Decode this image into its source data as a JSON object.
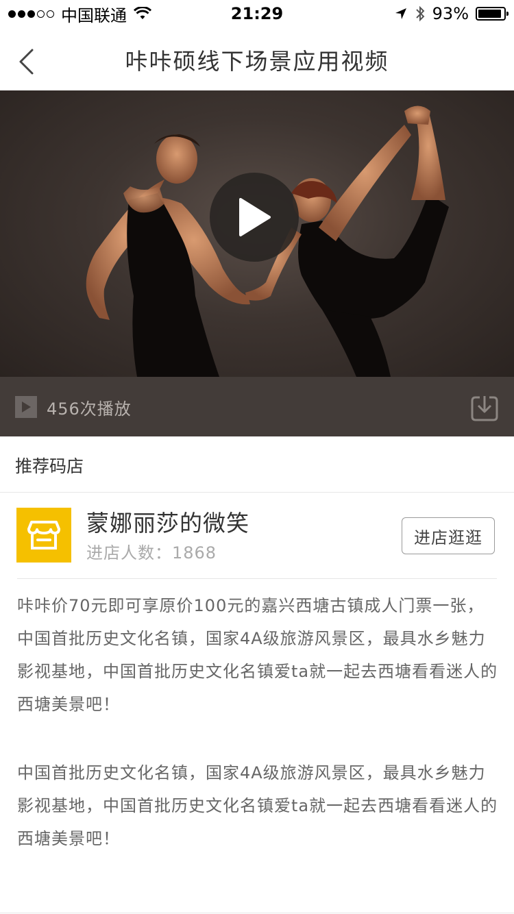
{
  "status_bar": {
    "carrier": "中国联通",
    "time": "21:29",
    "battery": "93%",
    "battery_level": 0.93
  },
  "nav": {
    "title": "咔咔硕线下场景应用视频"
  },
  "video": {
    "play_count": "456次播放"
  },
  "recommend": {
    "section_title": "推荐码店",
    "store_name": "蒙娜丽莎的微笑",
    "visitors": "进店人数：1868",
    "enter_button": "进店逛逛"
  },
  "description": {
    "paragraph_1": "咔咔价70元即可享原价100元的嘉兴西塘古镇成人门票一张，中国首批历史文化名镇，国家4A级旅游风景区，最具水乡魅力影视基地，中国首批历史文化名镇爱ta就一起去西塘看看迷人的西塘美景吧！",
    "paragraph_2": "中国首批历史文化名镇，国家4A级旅游风景区，最具水乡魅力影视基地，中国首批历史文化名镇爱ta就一起去西塘看看迷人的西塘美景吧！"
  },
  "icons": {
    "back": "back-chevron-icon",
    "play": "play-icon",
    "download": "download-icon",
    "store": "store-icon",
    "wifi": "wifi-icon",
    "location": "location-arrow-icon",
    "bluetooth": "bluetooth-icon"
  },
  "colors": {
    "store_logo": "#f5c000",
    "video_bar": "#433c39"
  }
}
